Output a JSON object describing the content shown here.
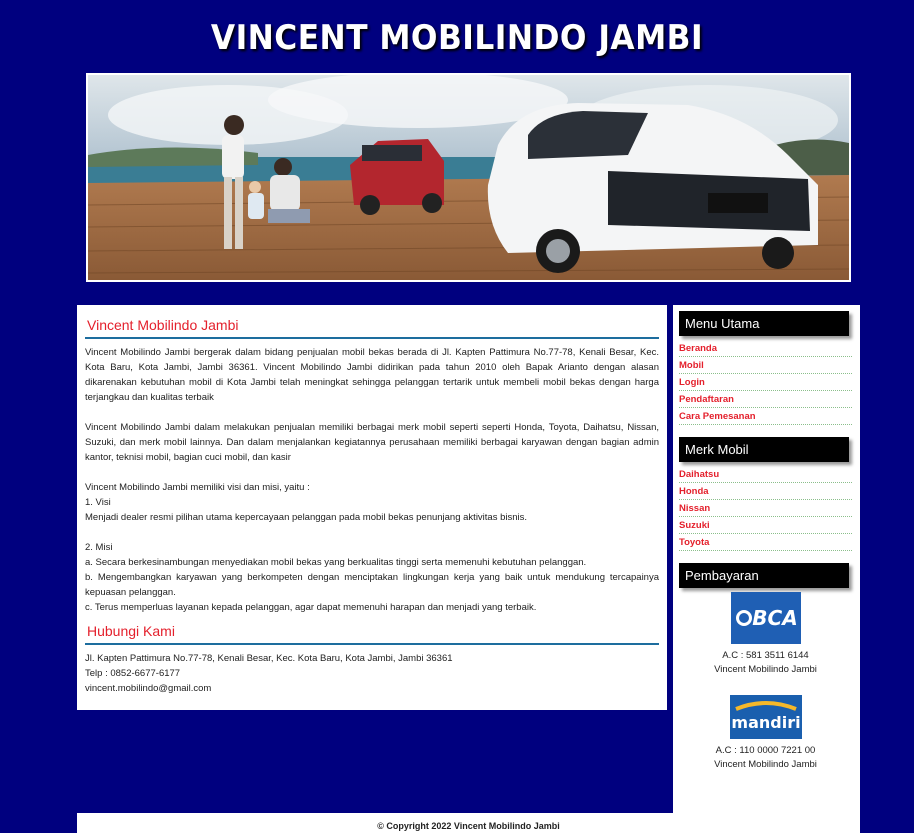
{
  "header": {
    "title": "VINCENT MOBILINDO JAMBI"
  },
  "main": {
    "about_title": "Vincent Mobilindo Jambi",
    "p1": "Vincent Mobilindo Jambi bergerak dalam bidang penjualan mobil bekas berada di Jl. Kapten Pattimura No.77-78, Kenali Besar, Kec. Kota Baru, Kota Jambi, Jambi 36361. Vincent Mobilindo Jambi didirikan pada tahun 2010 oleh Bapak Arianto dengan alasan dikarenakan kebutuhan mobil di Kota Jambi telah meningkat sehingga pelanggan tertarik untuk membeli mobil bekas dengan harga terjangkau dan kualitas terbaik",
    "p2": "Vincent Mobilindo Jambi dalam melakukan penjualan memiliki berbagai merk mobil seperti seperti Honda, Toyota, Daihatsu, Nissan, Suzuki, dan merk mobil lainnya. Dan dalam menjalankan kegiatannya perusahaan memiliki berbagai karyawan dengan bagian admin kantor, teknisi mobil, bagian cuci mobil, dan kasir",
    "p3": "Vincent Mobilindo Jambi memiliki visi dan misi, yaitu :",
    "visi_label": "1. Visi",
    "visi_text": "Menjadi dealer resmi pilihan utama kepercayaan pelanggan pada mobil bekas penunjang aktivitas bisnis.",
    "misi_label": "2. Misi",
    "misi_a": "a. Secara berkesinambungan menyediakan mobil bekas yang berkualitas tinggi serta memenuhi kebutuhan pelanggan.",
    "misi_b": "b. Mengembangkan karyawan yang berkompeten dengan menciptakan lingkungan kerja yang baik untuk mendukung tercapainya kepuasan pelanggan.",
    "misi_c": "c. Terus memperluas layanan kepada pelanggan, agar dapat memenuhi harapan dan menjadi yang terbaik.",
    "contact_title": "Hubungi Kami",
    "address": "Jl. Kapten Pattimura No.77-78, Kenali Besar, Kec. Kota Baru, Kota Jambi, Jambi 36361",
    "phone": "Telp : 0852-6677-6177",
    "email": "vincent.mobilindo@gmail.com"
  },
  "sidebar": {
    "menu_title": "Menu Utama",
    "menu": [
      "Beranda",
      "Mobil",
      "Login",
      "Pendaftaran",
      "Cara Pemesanan"
    ],
    "brand_title": "Merk Mobil",
    "brands": [
      "Daihatsu",
      "Honda",
      "Nissan",
      "Suzuki",
      "Toyota"
    ],
    "payment_title": "Pembayaran",
    "banks": [
      {
        "logo": "BCA",
        "account": "A.C : 581 3511 6144",
        "holder": "Vincent Mobilindo Jambi"
      },
      {
        "logo": "mandiri",
        "account": "A.C : 110 0000 7221 00",
        "holder": "Vincent Mobilindo Jambi"
      }
    ]
  },
  "footer": {
    "copyright": "© Copyright 2022 Vincent Mobilindo Jambi"
  },
  "colors": {
    "background": "#00007f",
    "accent_red": "#e4202c",
    "rule_blue": "#1d6d9e"
  }
}
